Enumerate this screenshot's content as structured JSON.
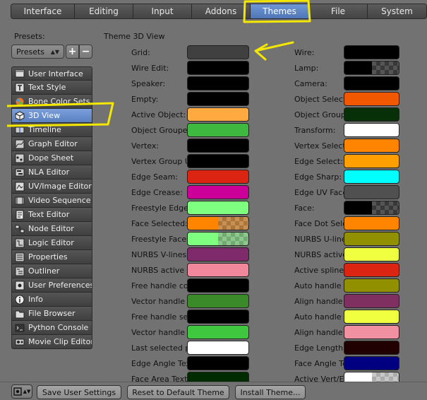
{
  "tabs": [
    "Interface",
    "Editing",
    "Input",
    "Addons",
    "Themes",
    "File",
    "System"
  ],
  "active_tab": "Themes",
  "presets": {
    "label": "Presets:",
    "select_value": "Presets",
    "add_label": "+",
    "remove_label": "−"
  },
  "categories": [
    {
      "label": "User Interface",
      "icon": "user-interface-icon"
    },
    {
      "label": "Text Style",
      "icon": "text-style-icon"
    },
    {
      "label": "Bone Color Sets",
      "icon": "bone-color-sets-icon"
    },
    {
      "label": "3D View",
      "icon": "3d-view-icon",
      "selected": true
    },
    {
      "label": "Timeline",
      "icon": "timeline-icon"
    },
    {
      "label": "Graph Editor",
      "icon": "graph-editor-icon"
    },
    {
      "label": "Dope Sheet",
      "icon": "dope-sheet-icon"
    },
    {
      "label": "NLA Editor",
      "icon": "nla-editor-icon"
    },
    {
      "label": "UV/Image Editor",
      "icon": "uv-image-editor-icon"
    },
    {
      "label": "Video Sequence E",
      "icon": "video-sequence-editor-icon"
    },
    {
      "label": "Text Editor",
      "icon": "text-editor-icon"
    },
    {
      "label": "Node Editor",
      "icon": "node-editor-icon"
    },
    {
      "label": "Logic Editor",
      "icon": "logic-editor-icon"
    },
    {
      "label": "Properties",
      "icon": "properties-icon"
    },
    {
      "label": "Outliner",
      "icon": "outliner-icon"
    },
    {
      "label": "User Preferences",
      "icon": "user-preferences-icon"
    },
    {
      "label": "Info",
      "icon": "info-icon"
    },
    {
      "label": "File Browser",
      "icon": "file-browser-icon"
    },
    {
      "label": "Python Console",
      "icon": "python-console-icon"
    },
    {
      "label": "Movie Clip Editor",
      "icon": "movie-clip-editor-icon"
    }
  ],
  "section_title": "Theme 3D View",
  "left_column": [
    {
      "label": "Grid:",
      "color": "#404040"
    },
    {
      "label": "Wire Edit:",
      "color": "#000000"
    },
    {
      "label": "Speaker:",
      "color": "#000000"
    },
    {
      "label": "Empty:",
      "color": "#000000"
    },
    {
      "label": "Active Object:",
      "color": "#ffaa40"
    },
    {
      "label": "Object Grouped",
      "color": "#3fb83f"
    },
    {
      "label": "Vertex:",
      "color": "#000000"
    },
    {
      "label": "Vertex Group U",
      "color": "#000000"
    },
    {
      "label": "Edge Seam:",
      "color": "#db2512"
    },
    {
      "label": "Edge Crease:",
      "color": "#cc0099"
    },
    {
      "label": "Freestyle Edge",
      "color": "#7fff7f"
    },
    {
      "label": "Face Selected:",
      "color": "#ff8500",
      "alpha": true
    },
    {
      "label": "Freestyle Face",
      "color": "#7fff7f",
      "alpha": true
    },
    {
      "label": "NURBS V-lines:",
      "color": "#7f2a6a"
    },
    {
      "label": "NURBS active V",
      "color": "#f0879a"
    },
    {
      "label": "Free handle col",
      "color": "#000000"
    },
    {
      "label": "Vector handle c",
      "color": "#3a8a2a"
    },
    {
      "label": "Free handle sel",
      "color": "#000000"
    },
    {
      "label": "Vector handle s",
      "color": "#3fc83f"
    },
    {
      "label": "Last selected p",
      "color": "#ffffff"
    },
    {
      "label": "Edge Angle Text",
      "color": "#000000"
    },
    {
      "label": "Face Area Text:",
      "color": "#002a00"
    }
  ],
  "right_column": [
    {
      "label": "Wire:",
      "color": "#000000"
    },
    {
      "label": "Lamp:",
      "color": "#000000",
      "alpha": true
    },
    {
      "label": "Camera:",
      "color": "#000000"
    },
    {
      "label": "Object Select",
      "color": "#f15800"
    },
    {
      "label": "Object Group",
      "color": "#083008"
    },
    {
      "label": "Transform:",
      "color": "#ffffff"
    },
    {
      "label": "Vertex Select:",
      "color": "#ff8500"
    },
    {
      "label": "Edge Select:",
      "color": "#ffa000"
    },
    {
      "label": "Edge Sharp:",
      "color": "#00ffff"
    },
    {
      "label": "Edge UV Face",
      "color": "#505050"
    },
    {
      "label": "Face:",
      "color": "#000000",
      "alpha": true
    },
    {
      "label": "Face Dot Sele",
      "color": "#ff8500"
    },
    {
      "label": "NURBS U-line",
      "color": "#909000"
    },
    {
      "label": "NURBS active",
      "color": "#f0ff40"
    },
    {
      "label": "Active spline:",
      "color": "#db2512"
    },
    {
      "label": "Auto handle c",
      "color": "#909000"
    },
    {
      "label": "Align handle c",
      "color": "#803060"
    },
    {
      "label": "Auto handle s",
      "color": "#f0ff40"
    },
    {
      "label": "Align handle s",
      "color": "#f090a0"
    },
    {
      "label": "Edge Length T",
      "color": "#200000"
    },
    {
      "label": "Face Angle Te",
      "color": "#000080"
    },
    {
      "label": "Active Vert/Ed",
      "color": "#ffffff",
      "alpha": true
    }
  ],
  "bottom": {
    "save": "Save User Settings",
    "reset": "Reset to Default Theme",
    "install": "Install Theme..."
  },
  "colors": {
    "highlight": "#f5e800",
    "tab_active": "#5a82c4",
    "background": "#727272"
  }
}
